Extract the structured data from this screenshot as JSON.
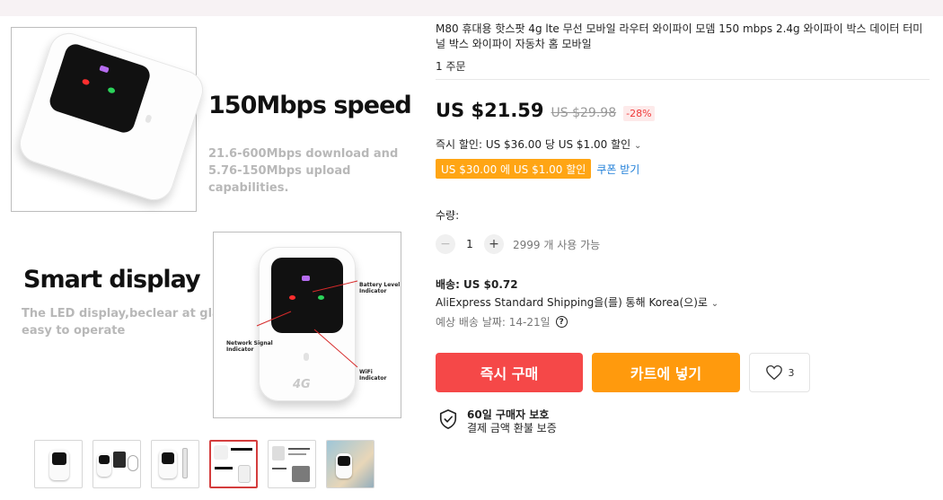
{
  "gallery": {
    "promo1": {
      "title": "150Mbps speed",
      "subtitle_lines": [
        "21.6-600Mbps download and",
        "5.76-150Mbps upload capabilities."
      ]
    },
    "promo2": {
      "title": "Smart display",
      "subtitle_lines": [
        "The LED display,beclear at glance,",
        "easy to operate"
      ],
      "callouts": {
        "battery": [
          "Battery Level",
          "Indicator"
        ],
        "network": [
          "Network Signal",
          "Indicator"
        ],
        "wifi": [
          "WiFi Indicator"
        ]
      },
      "device_label": "4G"
    },
    "thumbnails": [
      {
        "name": "thumb-1",
        "active": false
      },
      {
        "name": "thumb-2",
        "active": false
      },
      {
        "name": "thumb-3",
        "active": false
      },
      {
        "name": "thumb-4",
        "active": true
      },
      {
        "name": "thumb-5",
        "active": false
      },
      {
        "name": "thumb-6",
        "active": false
      }
    ]
  },
  "product": {
    "title": "M80 휴대용 핫스팟 4g lte 무선 모바일 라우터 와이파이 모뎀 150 mbps 2.4g 와이파이 박스 데이터 터미널 박스 와이파이 자동차 홈 모바일",
    "orders": "1 주문",
    "price": "US $21.59",
    "old_price": "US $29.98",
    "discount": "-28%",
    "instant_discount": "즉시 할인: US $36.00 당 US $1.00 할인",
    "coupon": "US $30.00 에 US $1.00 할인",
    "get_coupon": "쿠폰 받기",
    "quantity_label": "수량:",
    "quantity": "1",
    "availability": "2999 개 사용 가능",
    "shipping_title": "배송: US $0.72",
    "shipping_method": "AliExpress Standard Shipping을(를) 통해 Korea(으)로",
    "delivery_date": "예상 배송 날짜: 14-21일",
    "buy_now": "즉시 구매",
    "add_to_cart": "카트에 넣기",
    "wishlist_count": "3",
    "protection_title": "60일 구매자 보호",
    "protection_desc": "결제 금액 환불 보증"
  },
  "colors": {
    "buy_now": "#f54848",
    "add_to_cart": "#ff9a0d",
    "coupon": "#ffa514",
    "discount_text": "#f03a3a",
    "link": "#1e7ed8"
  },
  "icons": [
    "chevron-down-icon",
    "minus-icon",
    "plus-icon",
    "help-icon",
    "heart-icon",
    "shield-check-icon"
  ]
}
